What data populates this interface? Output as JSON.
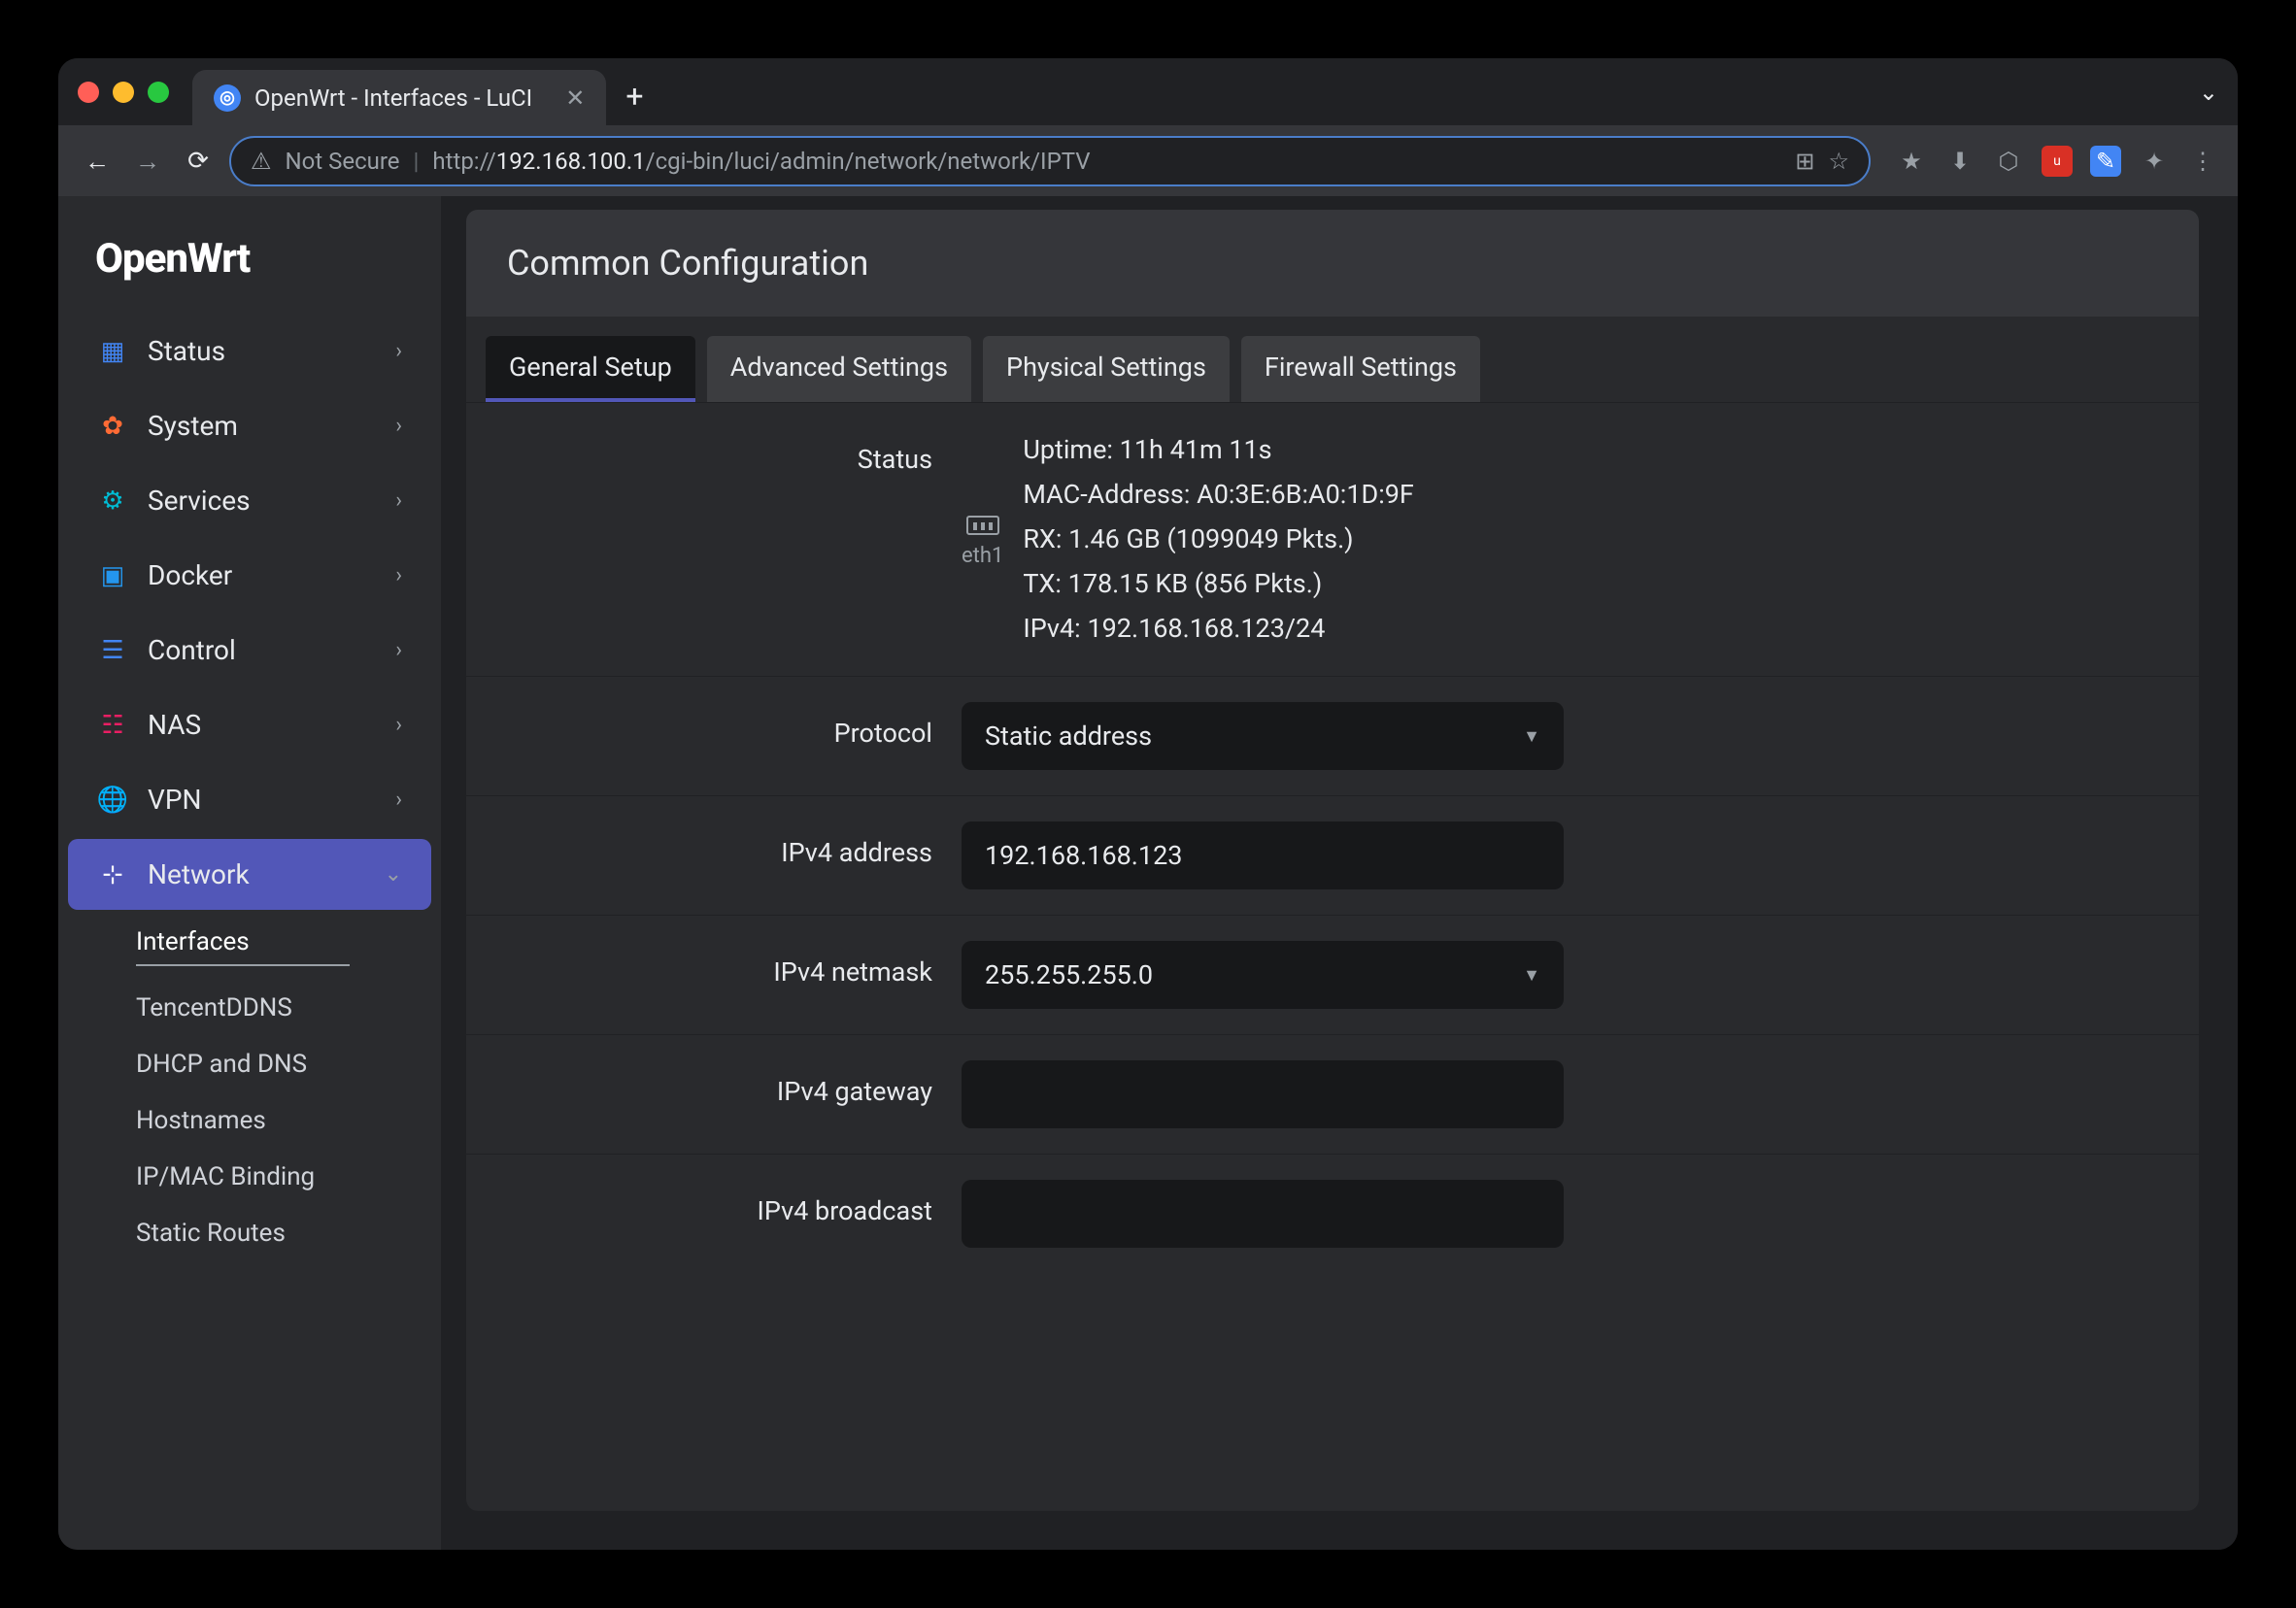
{
  "browser": {
    "tab_title": "OpenWrt - Interfaces - LuCI",
    "url_prefix": "Not Secure",
    "url_proto": "http://",
    "url_host": "192.168.100.1",
    "url_path": "/cgi-bin/luci/admin/network/network/IPTV"
  },
  "logo": "OpenWrt",
  "sidebar": {
    "items": [
      {
        "label": "Status"
      },
      {
        "label": "System"
      },
      {
        "label": "Services"
      },
      {
        "label": "Docker"
      },
      {
        "label": "Control"
      },
      {
        "label": "NAS"
      },
      {
        "label": "VPN"
      },
      {
        "label": "Network"
      }
    ],
    "submenu": [
      {
        "label": "Interfaces"
      },
      {
        "label": "TencentDDNS"
      },
      {
        "label": "DHCP and DNS"
      },
      {
        "label": "Hostnames"
      },
      {
        "label": "IP/MAC Binding"
      },
      {
        "label": "Static Routes"
      }
    ]
  },
  "panel": {
    "title": "Common Configuration",
    "tabs": [
      {
        "label": "General Setup"
      },
      {
        "label": "Advanced Settings"
      },
      {
        "label": "Physical Settings"
      },
      {
        "label": "Firewall Settings"
      }
    ],
    "status_label": "Status",
    "eth_label": "eth1",
    "status": {
      "uptime_k": "Uptime:",
      "uptime_v": "11h 41m 11s",
      "mac_k": "MAC-Address:",
      "mac_v": "A0:3E:6B:A0:1D:9F",
      "rx_k": "RX:",
      "rx_v": "1.46 GB (1099049 Pkts.)",
      "tx_k": "TX:",
      "tx_v": "178.15 KB (856 Pkts.)",
      "ipv4_k": "IPv4:",
      "ipv4_v": "192.168.168.123/24"
    },
    "fields": {
      "protocol_label": "Protocol",
      "protocol_value": "Static address",
      "ipv4_addr_label": "IPv4 address",
      "ipv4_addr_value": "192.168.168.123",
      "ipv4_netmask_label": "IPv4 netmask",
      "ipv4_netmask_value": "255.255.255.0",
      "ipv4_gateway_label": "IPv4 gateway",
      "ipv4_gateway_value": "",
      "ipv4_broadcast_label": "IPv4 broadcast",
      "ipv4_broadcast_value": ""
    }
  }
}
